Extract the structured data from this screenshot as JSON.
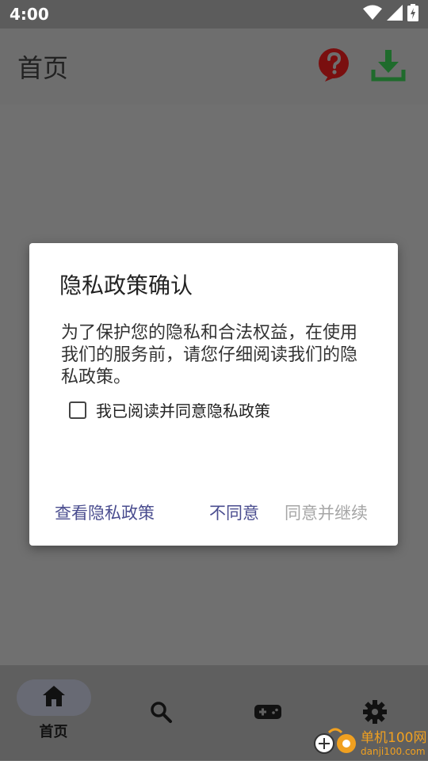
{
  "status_bar": {
    "time": "4:00",
    "icons": [
      "wifi-icon",
      "signal-icon",
      "battery-charging-icon"
    ]
  },
  "app_bar": {
    "title": "首页",
    "actions": [
      {
        "name": "help-icon",
        "color": "#7a0f0f"
      },
      {
        "name": "download-icon",
        "color": "#1f6b2c"
      }
    ]
  },
  "dialog": {
    "title": "隐私政策确认",
    "body": "为了保护您的隐私和合法权益，在使用我们的服务前，请您仔细阅读我们的隐私政策。",
    "checkbox_label": "我已阅读并同意隐私政策",
    "checkbox_checked": false,
    "buttons": {
      "view_policy": "查看隐私政策",
      "disagree": "不同意",
      "agree_continue": "同意并继续"
    },
    "button_colors": {
      "primary": "#4a4d8f",
      "disabled": "#a6a6a6"
    }
  },
  "bottom_nav": {
    "items": [
      {
        "name": "home",
        "label": "首页",
        "active": true
      },
      {
        "name": "search",
        "label": "",
        "active": false
      },
      {
        "name": "games",
        "label": "",
        "active": false
      },
      {
        "name": "settings",
        "label": "",
        "active": false
      }
    ]
  },
  "watermark": {
    "text_cn": "单机100网",
    "text_en": "danji100.com"
  }
}
